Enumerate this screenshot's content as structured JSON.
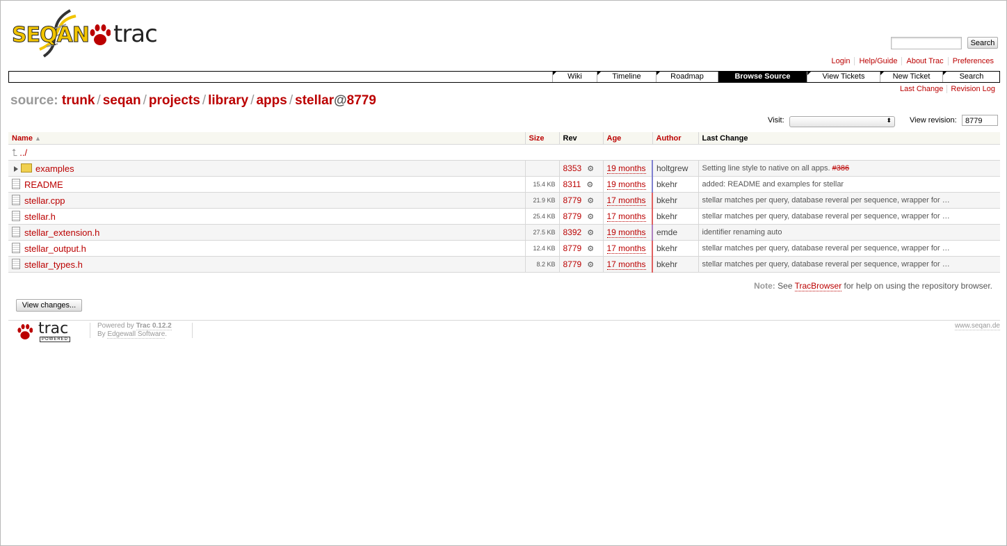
{
  "logo": {
    "brand": "SEQAN",
    "product": "trac"
  },
  "search": {
    "placeholder": "",
    "button": "Search"
  },
  "metanav": [
    "Login",
    "Help/Guide",
    "About Trac",
    "Preferences"
  ],
  "mainnav": [
    {
      "label": "Wiki",
      "active": false
    },
    {
      "label": "Timeline",
      "active": false
    },
    {
      "label": "Roadmap",
      "active": false
    },
    {
      "label": "Browse Source",
      "active": true
    },
    {
      "label": "View Tickets",
      "active": false
    },
    {
      "label": "New Ticket",
      "active": false
    },
    {
      "label": "Search",
      "active": false
    }
  ],
  "ctxtnav": [
    "Last Change",
    "Revision Log"
  ],
  "breadcrumb": {
    "prefix": "source:",
    "segments": [
      "trunk",
      "seqan",
      "projects",
      "library",
      "apps",
      "stellar"
    ],
    "separator": "/",
    "at": "@",
    "revision": "8779"
  },
  "visit": {
    "label": "Visit:",
    "value": ""
  },
  "view_revision": {
    "label": "View revision:",
    "value": "8779"
  },
  "table": {
    "headers": {
      "name": "Name",
      "size": "Size",
      "rev": "Rev",
      "age": "Age",
      "author": "Author",
      "change": "Last Change"
    },
    "parent": "../",
    "rows": [
      {
        "type": "dir",
        "name": "examples",
        "size": "",
        "rev": "8353",
        "age": "19 months",
        "author": "holtgrew",
        "change": "Setting line style to native on all apps.",
        "ticket": "#386"
      },
      {
        "type": "file",
        "name": "README",
        "size": "15.4 KB",
        "rev": "8311",
        "age": "19 months",
        "author": "bkehr",
        "change": "added: README and examples for stellar",
        "ticket": ""
      },
      {
        "type": "file",
        "name": "stellar.cpp",
        "size": "21.9 KB",
        "rev": "8779",
        "age": "17 months",
        "author": "bkehr",
        "change": "stellar matches per query, database reveral per sequence, wrapper for …",
        "ticket": ""
      },
      {
        "type": "file",
        "name": "stellar.h",
        "size": "25.4 KB",
        "rev": "8779",
        "age": "17 months",
        "author": "bkehr",
        "change": "stellar matches per query, database reveral per sequence, wrapper for …",
        "ticket": ""
      },
      {
        "type": "file",
        "name": "stellar_extension.h",
        "size": "27.5 KB",
        "rev": "8392",
        "age": "19 months",
        "author": "emde",
        "change": "identifier renaming auto",
        "ticket": ""
      },
      {
        "type": "file",
        "name": "stellar_output.h",
        "size": "12.4 KB",
        "rev": "8779",
        "age": "17 months",
        "author": "bkehr",
        "change": "stellar matches per query, database reveral per sequence, wrapper for …",
        "ticket": ""
      },
      {
        "type": "file",
        "name": "stellar_types.h",
        "size": "8.2 KB",
        "rev": "8779",
        "age": "17 months",
        "author": "bkehr",
        "change": "stellar matches per query, database reveral per sequence, wrapper for …",
        "ticket": ""
      }
    ]
  },
  "note": {
    "label": "Note:",
    "before": "See",
    "link": "TracBrowser",
    "after": "for help on using the repository browser."
  },
  "view_changes_button": "View changes...",
  "footer": {
    "logo_text": "trac",
    "badge": "POWERED",
    "powered_by": "Powered by",
    "trac_version": "Trac 0.12.2",
    "by": "By",
    "company": "Edgewall Software",
    "period": ".",
    "site": "www.seqan.de"
  },
  "colors": {
    "link": "#bb0000",
    "header_bg": "#f7f7f0",
    "active_tab": "#000000"
  }
}
